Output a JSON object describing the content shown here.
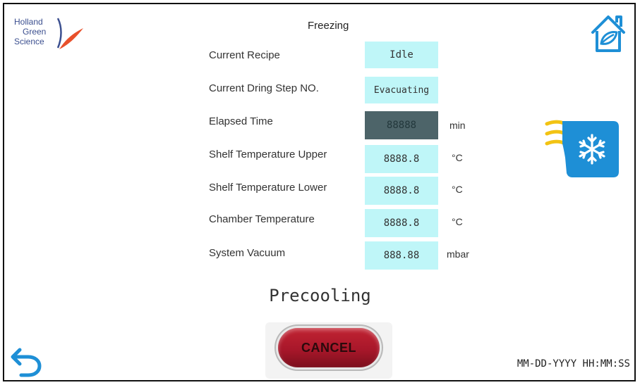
{
  "logo": {
    "line1": "Holland",
    "line2": "Green",
    "line3": "Science"
  },
  "header": {
    "title": "Freezing"
  },
  "fields": [
    {
      "label": "Current Recipe",
      "value": "Idle",
      "unit": ""
    },
    {
      "label": "Current Dring Step NO.",
      "value": "Evacuating",
      "unit": ""
    },
    {
      "label": "Elapsed Time",
      "value": "88888",
      "unit": "min"
    },
    {
      "label": "Shelf Temperature Upper",
      "value": "8888.8",
      "unit": "°C"
    },
    {
      "label": "Shelf Temperature Lower",
      "value": "8888.8",
      "unit": "°C"
    },
    {
      "label": "Chamber Temperature",
      "value": "8888.8",
      "unit": "°C"
    },
    {
      "label": "System Vacuum",
      "value": "888.88",
      "unit": "mbar"
    }
  ],
  "status": {
    "text": "Precooling"
  },
  "actions": {
    "cancel_label": "CANCEL"
  },
  "footer": {
    "datetime": "MM-DD-YYYY HH:MM:SS"
  },
  "colors": {
    "field_bg": "#bff6f8",
    "field_dark_bg": "#4d6469",
    "cancel": "#b21c2c",
    "icon_blue": "#1e8fd6",
    "icon_yellow": "#f2c313"
  },
  "icons": {
    "home": "home-leaf-icon",
    "back": "back-arrow-icon",
    "freeze": "snowflake-freeze-icon"
  }
}
